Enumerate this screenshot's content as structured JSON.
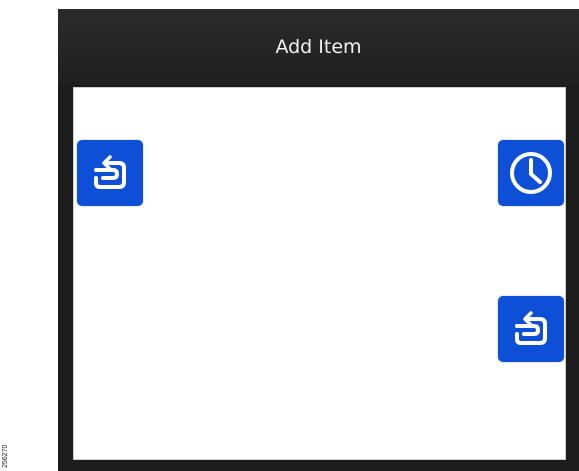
{
  "figure_id": "256270",
  "window": {
    "title": "Add Item"
  },
  "icons": {
    "top_left": "return-icon",
    "top_right": "clock-icon",
    "bottom_right": "return-icon"
  },
  "colors": {
    "title_bar": "#1f1f1f",
    "icon_button": "#0e4fd8",
    "icon_glyph": "#ffffff",
    "content_background": "#ffffff"
  }
}
